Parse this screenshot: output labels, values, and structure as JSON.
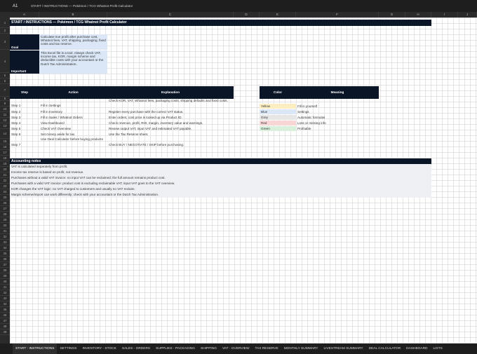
{
  "formula_bar": {
    "cell_ref": "A1",
    "content": "START / INSTRUCTIONS — Pokémon / TCG Whatnot Profit Calculator"
  },
  "columns": [
    "A",
    "B",
    "C",
    "D",
    "E",
    "F",
    "G",
    "H",
    "I",
    "J"
  ],
  "rows": [
    "1",
    "2",
    "3",
    "4",
    "5",
    "6",
    "7",
    "8",
    "9",
    "10",
    "11",
    "12",
    "13",
    "14",
    "15",
    "16",
    "17",
    "18",
    "19",
    "20",
    "21",
    "22",
    "23",
    "24",
    "25",
    "26",
    "27",
    "28",
    "29",
    "30",
    "31",
    "32",
    "33",
    "34",
    "35",
    "36",
    "37",
    "38",
    "39",
    "40",
    "41",
    "42",
    "43",
    "44",
    "45",
    "46",
    "47",
    "48",
    "49"
  ],
  "sheet": {
    "title": "START / INSTRUCTIONS — Pokémon / TCG Whatnot Profit Calculator",
    "goal_label": "Goal",
    "goal_text": "Calculate true profit after purchase cost, Whatnot fees, VAT, shipping, packaging, fixed costs and tax reserve.",
    "important_label": "Important",
    "important_text": "This Excel file is a tool. Always check VAT, income tax, KOR, margin scheme and deductible costs with your accountant or the Dutch Tax Administration.",
    "steps_header": {
      "step": "Step",
      "action": "Action",
      "explanation": "Explanation"
    },
    "steps": [
      {
        "step": "Step 1",
        "action": "Fill in Settings",
        "explanation": "Check KOR, VAT, Whatnot fees, packaging costs, shipping defaults and fixed costs."
      },
      {
        "step": "Step 2",
        "action": "Fill in Inventory",
        "explanation": "Register every purchase with the correct VAT status."
      },
      {
        "step": "Step 3",
        "action": "Fill in Sales / Whatnot Orders",
        "explanation": "Enter orders; cost price is looked up via Product ID."
      },
      {
        "step": "Step 4",
        "action": "View Dashboard",
        "explanation": "Check revenue, profit, ROI, margin, inventory value and warnings."
      },
      {
        "step": "Step 5",
        "action": "Check VAT Overview",
        "explanation": "Review output VAT, input VAT and estimated VAT payable."
      },
      {
        "step": "Step 6",
        "action": "Set money aside for tax",
        "explanation": "Use the Tax Reserve sheet."
      },
      {
        "step": "Step 7",
        "action": "Use Deal Calculator before buying products",
        "explanation": "Check BUY / NEGOTIATE / SKIP before purchasing."
      }
    ],
    "legend_header": {
      "color": "Color",
      "meaning": "Meaning"
    },
    "legend": [
      {
        "color": "Yellow",
        "meaning": "Fill in yourself",
        "swatch": "#fdeec2"
      },
      {
        "color": "Blue",
        "meaning": "Settings",
        "swatch": "#dbe7f6"
      },
      {
        "color": "Grey",
        "meaning": "Automatic formulas",
        "swatch": "#e6e6e6"
      },
      {
        "color": "Red",
        "meaning": "Loss or missing info",
        "swatch": "#f8d6d6"
      },
      {
        "color": "Green",
        "meaning": "Profitable",
        "swatch": "#d8f0dc"
      }
    ],
    "notes_title": "Accounting notes",
    "notes": [
      "VAT is calculated separately from profit.",
      "Income tax reserve is based on profit, not revenue.",
      "Purchases without a valid VAT invoice: no input VAT can be reclaimed; the full amount remains product cost.",
      "Purchases with a valid VAT invoice: product cost is excluding reclaimable VAT; input VAT goes to the VAT overview.",
      "KOR changes the VAT logic: no VAT charged to customers and usually no VAT reclaim.",
      "Margin scheme/import can work differently; check with your accountant or the Dutch Tax Administration."
    ]
  },
  "tabs": [
    "START - INSTRUCTIONS",
    "SETTINGS",
    "INVENTORY - STOCK",
    "SALES - ORDERS",
    "SUPPLIES - PACKAGING",
    "SHIPPING",
    "VAT - OVERVIEW",
    "TAX RESERVE",
    "MONTHLY SUMMARY",
    "LIVESTREAM SUMMARY",
    "DEAL CALCULATOR",
    "DASHBOARD",
    "LISTS"
  ],
  "colors": {
    "header_dark": "#0b1528",
    "chrome": "#1e1e1e",
    "accent_blue": "#dbe7f6"
  }
}
